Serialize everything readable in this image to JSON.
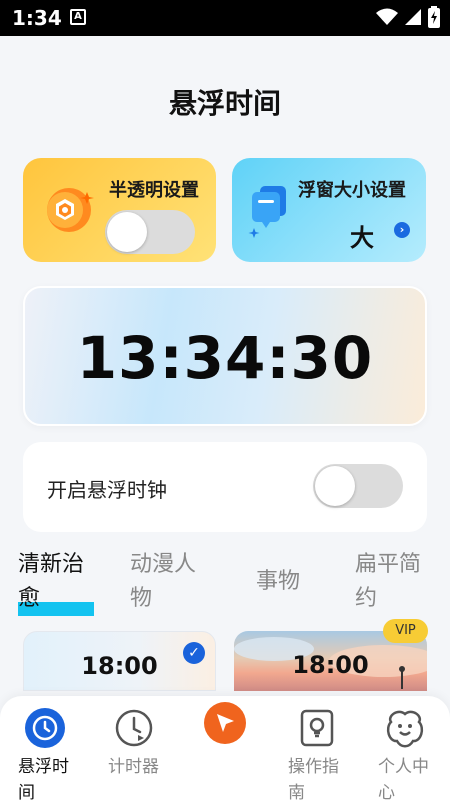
{
  "status_bar": {
    "time": "1:34",
    "a_badge": "A"
  },
  "page_title": "悬浮时间",
  "transparency_card": {
    "title": "半透明设置",
    "toggle_on": false
  },
  "size_card": {
    "title": "浮窗大小设置",
    "value": "大",
    "arrow": "›"
  },
  "clock_display": "13:34:30",
  "float_clock": {
    "label": "开启悬浮时钟",
    "toggle_on": false
  },
  "style_tabs": [
    {
      "line1": "清新治",
      "line2": "愈",
      "active": true
    },
    {
      "line1": "动漫人",
      "line2": "物",
      "active": false
    },
    {
      "line1": "事物",
      "line2": "",
      "active": false
    },
    {
      "line1": "扁平简",
      "line2": "约",
      "active": false
    }
  ],
  "themes": [
    {
      "time": "18:00",
      "selected": true,
      "check": "✓"
    },
    {
      "time": "18:00",
      "vip": "VIP"
    }
  ],
  "bottom_nav": [
    {
      "line1": "悬浮时",
      "line2": "间",
      "icon": "clock-face-icon",
      "active": true
    },
    {
      "line1": "计时器",
      "line2": "",
      "icon": "timer-icon",
      "active": false
    },
    {
      "line1": "",
      "line2": "",
      "icon": "cursor-icon",
      "active": false
    },
    {
      "line1": "操作指",
      "line2": "南",
      "icon": "guide-book-icon",
      "active": false
    },
    {
      "line1": "个人中",
      "line2": "心",
      "icon": "smile-flower-icon",
      "active": false
    }
  ],
  "colors": {
    "accent_blue": "#1a63db",
    "tab_underline": "#13c3f0",
    "card_yellow": "#ffc53d",
    "card_blue": "#5fd2f7",
    "vip": "#f7cc35",
    "nav_orange": "#f0641e"
  }
}
